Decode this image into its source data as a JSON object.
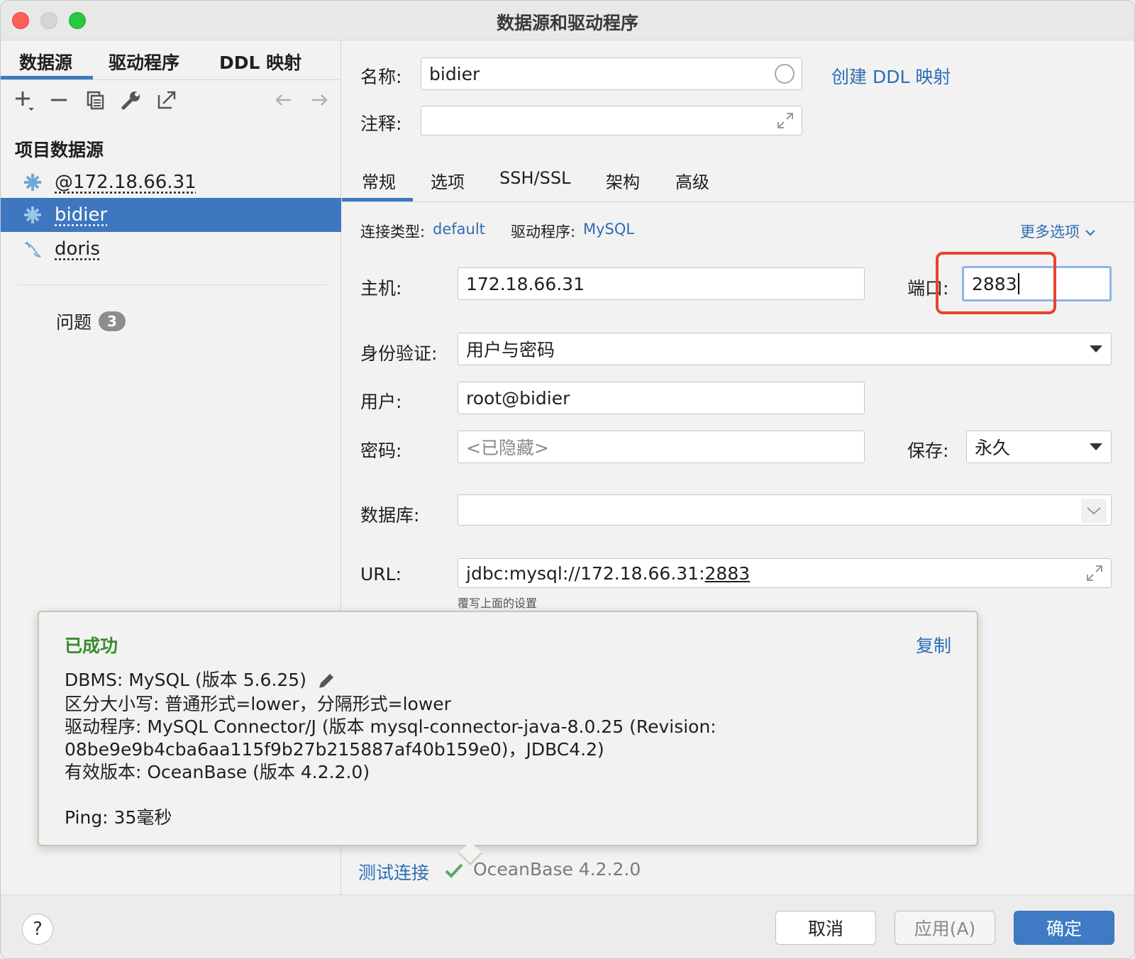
{
  "window": {
    "title": "数据源和驱动程序"
  },
  "left": {
    "tabs": [
      "数据源",
      "驱动程序",
      "DDL 映射"
    ],
    "section_title": "项目数据源",
    "datasources": [
      {
        "label": "@172.18.66.31",
        "icon": "oceanbase-icon",
        "selected": false
      },
      {
        "label": "bidier",
        "icon": "oceanbase-icon",
        "selected": true
      },
      {
        "label": "doris",
        "icon": "mysql-dolphin-icon",
        "selected": false
      }
    ],
    "problems_label": "问题",
    "problems_count": "3"
  },
  "form": {
    "name_label": "名称:",
    "name_value": "bidier",
    "create_ddl_link": "创建 DDL 映射",
    "comment_label": "注释:",
    "comment_value": "",
    "tabs": [
      "常规",
      "选项",
      "SSH/SSL",
      "架构",
      "高级"
    ],
    "conn_type_label": "连接类型:",
    "conn_type_value": "default",
    "driver_label": "驱动程序:",
    "driver_value": "MySQL",
    "more_options": "更多选项",
    "host_label": "主机:",
    "host_value": "172.18.66.31",
    "port_label": "端口:",
    "port_value": "2883",
    "auth_label": "身份验证:",
    "auth_value": "用户与密码",
    "user_label": "用户:",
    "user_value": "root@bidier",
    "password_label": "密码:",
    "password_placeholder": "<已隐藏>",
    "save_label": "保存:",
    "save_value": "永久",
    "database_label": "数据库:",
    "database_value": "",
    "url_label": "URL:",
    "url_prefix": "jdbc:mysql://172.18.66.31:",
    "url_port": "2883",
    "url_hint": "覆写上面的设置"
  },
  "popup": {
    "title": "已成功",
    "copy": "复制",
    "lines": [
      "DBMS: MySQL (版本 5.6.25)",
      "区分大小写: 普通形式=lower，分隔形式=lower",
      "驱动程序: MySQL Connector/J (版本 mysql-connector-java-8.0.25 (Revision:",
      "08be9e9b4cba6aa115f9b27b215887af40b159e0)，JDBC4.2)",
      "有效版本: OceanBase (版本 4.2.2.0)"
    ],
    "ping": "Ping: 35毫秒"
  },
  "status": {
    "test_connection": "测试连接",
    "result": "OceanBase 4.2.2.0"
  },
  "footer": {
    "help": "?",
    "cancel": "取消",
    "apply": "应用(A)",
    "ok": "确定"
  },
  "colors": {
    "accent": "#3e77c0",
    "link": "#2e6db5",
    "success": "#3a8a2f",
    "highlight_box": "#e8432c"
  }
}
